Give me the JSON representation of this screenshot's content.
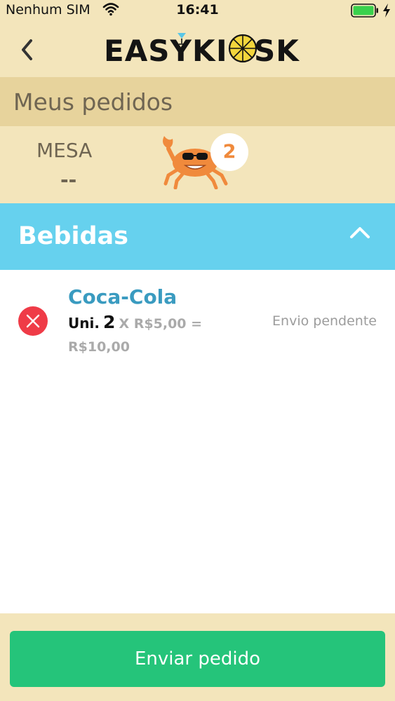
{
  "status_bar": {
    "carrier": "Nenhum SIM",
    "time": "16:41",
    "wifi_icon": "wifi-icon",
    "battery_icon": "battery-charging-icon"
  },
  "nav": {
    "back_icon": "chevron-left-icon",
    "logo_left": "EASY",
    "logo_k": "K",
    "logo_i": "I",
    "logo_right": "SK"
  },
  "page": {
    "title": "Meus pedidos"
  },
  "table_info": {
    "mesa_label": "MESA",
    "mesa_value": "--",
    "mascot_icon": "crab-mascot-icon",
    "badge_count": "2"
  },
  "category": {
    "title": "Bebidas",
    "toggle_icon": "chevron-up-icon",
    "color": "#66d1ee"
  },
  "order_items": [
    {
      "name": "Coca-Cola",
      "uni_label": "Uni.",
      "quantity": "2",
      "unit_price_text": "X R$5,00 =",
      "total": "R$10,00",
      "status": "Envio pendente",
      "remove_icon": "close-icon"
    }
  ],
  "actions": {
    "send_label": "Enviar pedido",
    "send_color": "#25c47a"
  },
  "colors": {
    "background": "#f3e5bb",
    "header_band": "#e7d39c",
    "remove": "#ef3b47",
    "item_name": "#3a9bc0"
  }
}
